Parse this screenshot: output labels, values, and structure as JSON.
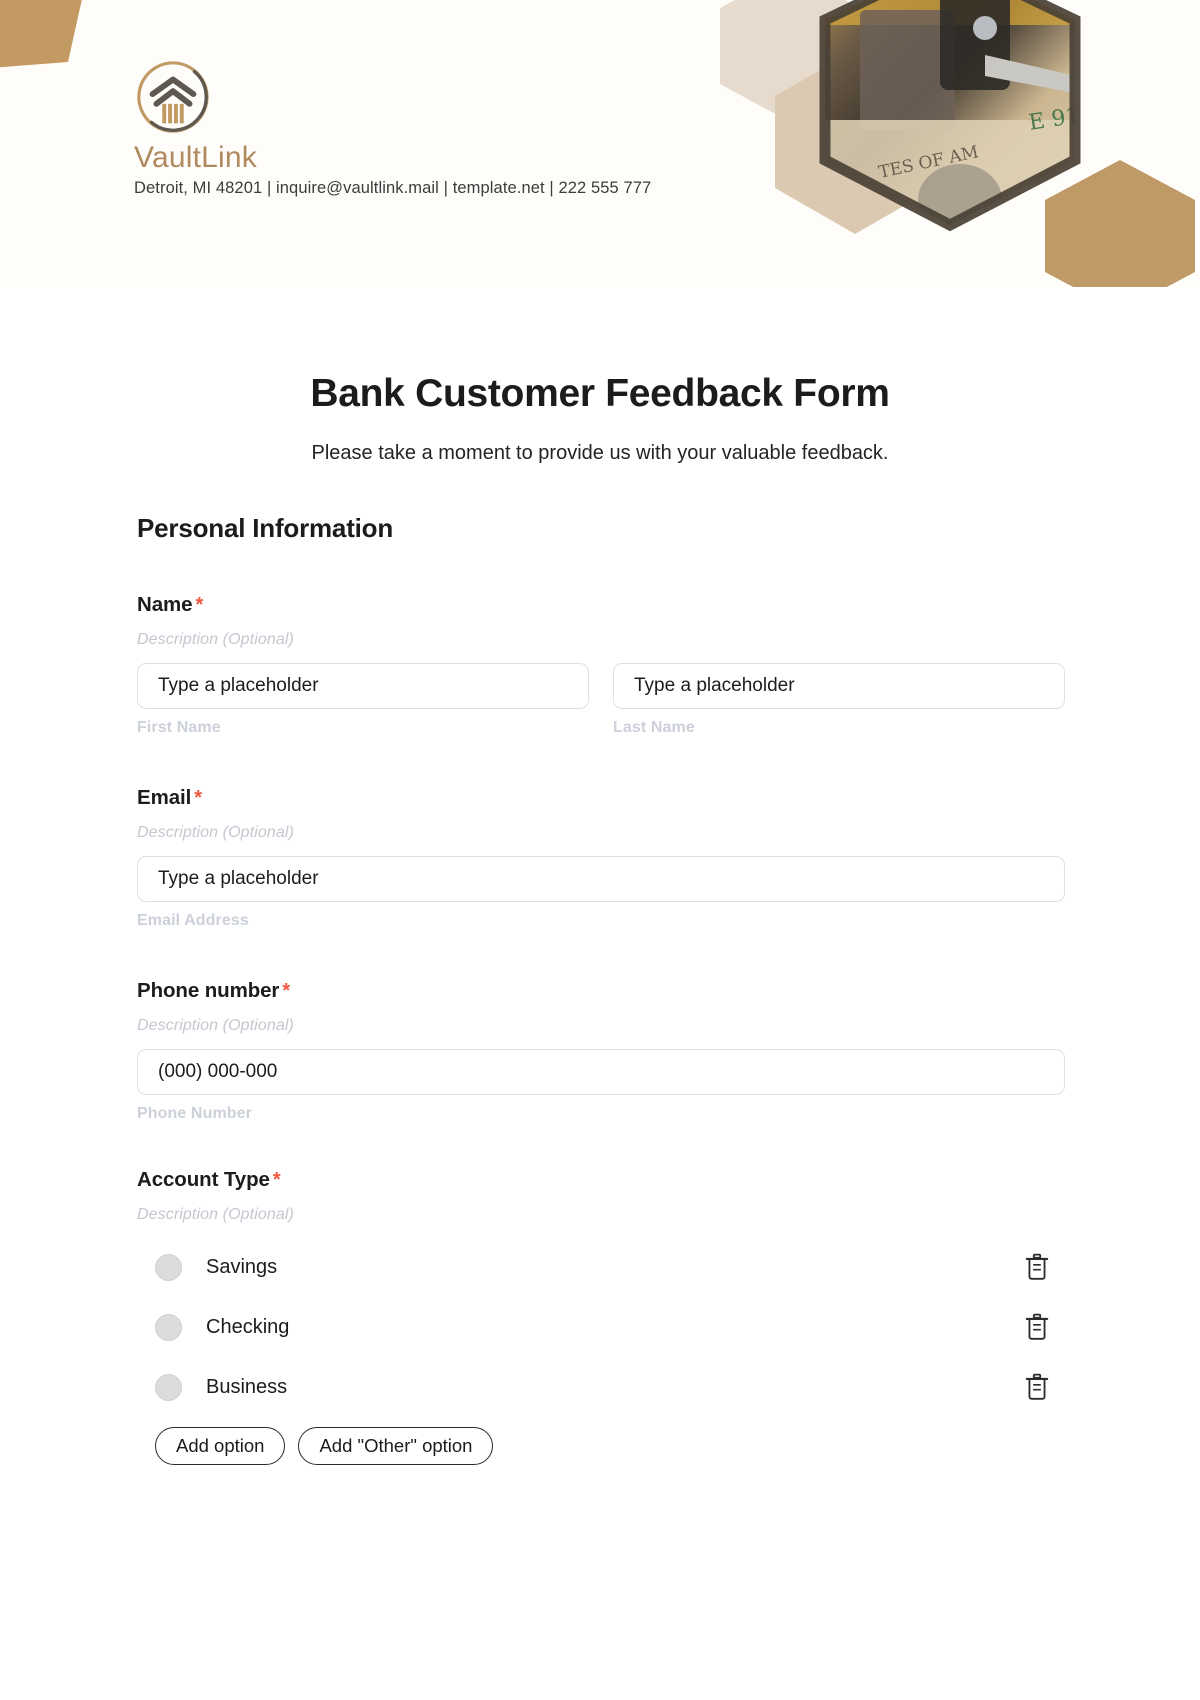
{
  "brand": {
    "name": "VaultLink",
    "contact": "Detroit, MI 48201 | inquire@vaultlink.mail | template.net | 222 555 777",
    "accent_color": "#b08a5e",
    "logo_icon": "vault-pillar-emblem-icon"
  },
  "form": {
    "title": "Bank Customer Feedback Form",
    "subtitle": "Please take a moment to provide us with your valuable feedback.",
    "section_heading": "Personal Information",
    "required_marker": "*",
    "required_color": "#f2553d",
    "description_placeholder": "Description (Optional)"
  },
  "fields": {
    "name": {
      "label": "Name",
      "required": "*",
      "description": "Description (Optional)",
      "first": {
        "placeholder": "Type a placeholder",
        "sub_label": "First Name"
      },
      "last": {
        "placeholder": "Type a placeholder",
        "sub_label": "Last Name"
      }
    },
    "email": {
      "label": "Email",
      "required": "*",
      "description": "Description (Optional)",
      "placeholder": "Type a placeholder",
      "sub_label": "Email Address"
    },
    "phone": {
      "label": "Phone number",
      "required": "*",
      "description": "Description (Optional)",
      "placeholder": "(000) 000-000",
      "sub_label": "Phone Number"
    },
    "account_type": {
      "label": "Account Type",
      "required": "*",
      "description": "Description (Optional)",
      "options": [
        {
          "label": "Savings",
          "delete_icon": "trash-icon"
        },
        {
          "label": "Checking",
          "delete_icon": "trash-icon"
        },
        {
          "label": "Business",
          "delete_icon": "trash-icon"
        }
      ],
      "add_option_label": "Add option",
      "add_other_option_label": "Add \"Other\" option"
    }
  }
}
